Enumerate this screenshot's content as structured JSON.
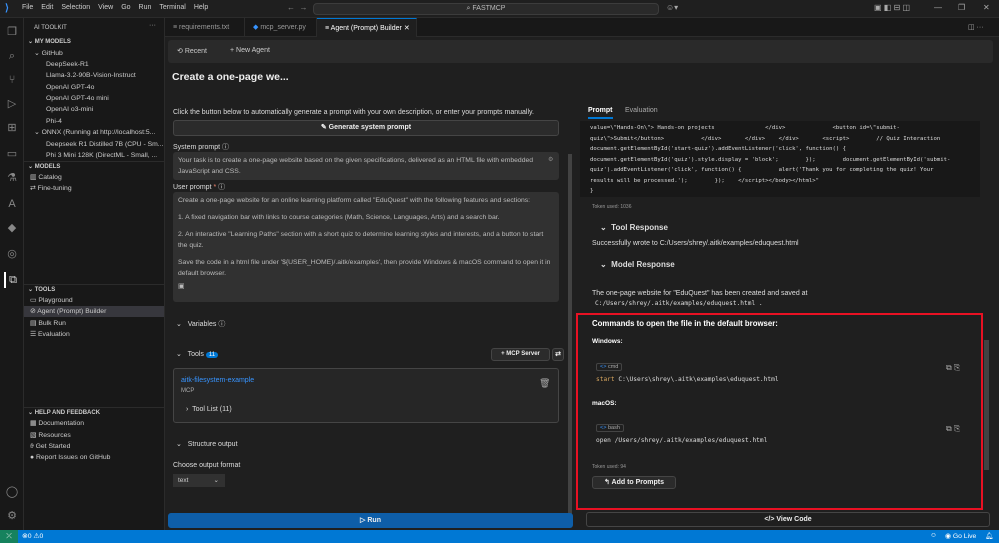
{
  "titlebar": {
    "menu": [
      "File",
      "Edit",
      "Selection",
      "View",
      "Go",
      "Run",
      "Terminal",
      "Help"
    ],
    "search": "FASTMCP"
  },
  "sidebar": {
    "title": "AI TOOLKIT",
    "my_models": "MY MODELS",
    "github": "GitHub",
    "github_models": [
      "DeepSeek-R1",
      "Llama-3.2-90B-Vision-Instruct",
      "OpenAI GPT-4o",
      "OpenAI GPT-4o mini",
      "OpenAI o3-mini",
      "Phi-4"
    ],
    "onnx": "ONNX (Running at http://localhost:5...",
    "onnx_models": [
      "Deepseek R1 Distilled 7B (CPU - Sm...",
      "Phi 3 Mini 128K (DirectML - Small, ..."
    ],
    "models": "MODELS",
    "models_items": [
      "Catalog",
      "Fine-tuning"
    ],
    "tools": "TOOLS",
    "tools_items": [
      "Playground",
      "Agent (Prompt) Builder",
      "Bulk Run",
      "Evaluation"
    ],
    "help": "HELP AND FEEDBACK",
    "help_items": [
      "Documentation",
      "Resources",
      "Get Started",
      "Report Issues on GitHub"
    ]
  },
  "tabs": [
    {
      "label": "requirements.txt"
    },
    {
      "label": "mcp_server.py"
    },
    {
      "label": "Agent (Prompt) Builder"
    }
  ],
  "toolbar": {
    "recent": "Recent",
    "new_agent": "New Agent"
  },
  "page_title": "Create a one-page we...",
  "left": {
    "hint": "Click the button below to automatically generate a prompt with your own description, or enter your prompts manually.",
    "generate": "Generate system prompt",
    "system_label": "System prompt",
    "system_prompt": "Your task is to create a one-page website based on the given specifications, delivered as an HTML file with embedded JavaScript and CSS.",
    "user_label": "User prompt",
    "required": "*",
    "user_prompt": [
      "Create a one-page website for an online learning platform called \"EduQuest\" with the following features and sections:",
      "1. A fixed navigation bar with links to course categories (Math, Science, Languages, Arts) and a search bar.",
      "2. An interactive \"Learning Paths\" section with a short quiz to determine learning styles and interests, and a button to start the quiz.",
      "Save the code in a html file under '${USER_HOME}/.aitk/examples', then provide Windows & macOS command to open it in default browser."
    ],
    "variables": "Variables",
    "tools": "Tools",
    "tools_count": "11",
    "mcp_server": "MCP Server",
    "tool_name": "aitk-filesystem-example",
    "tool_type": "MCP",
    "tool_list": "Tool List (11)",
    "structure": "Structure output",
    "format_label": "Choose output format",
    "format_value": "text",
    "run": "Run"
  },
  "right": {
    "tabs": [
      "Prompt",
      "Evaluation"
    ],
    "code": "value=\\\"Hands-On\\\"> Hands-on projects               </div>              <button id=\\\"submit-\nquiz\\\">Submit</button>           </div>       </div>    </div>       <script>        // Quiz Interaction\ndocument.getElementById('start-quiz').addEventListener('click', function() {\ndocument.getElementById('quiz').style.display = 'block';        });        document.getElementById('submit-\nquiz').addEventListener('click', function() {           alert('Thank you for completing the quiz! Your\nresults will be processed.');        });    </script></body></html>\"\n}",
    "token1": "Token used: 1036",
    "tool_response": "Tool Response",
    "tool_response_text": "Successfully wrote to C:/Users/shrey/.aitk/examples/eduquest.html",
    "model_response": "Model Response",
    "model_text": "The one-page website for \"EduQuest\" has been created and saved at",
    "model_path": "C:/Users/shrey/.aitk/examples/eduquest.html",
    "commands_heading": "Commands to open the file in the default browser:",
    "windows": "Windows:",
    "cmd_lang": "cmd",
    "cmd_kw": "start",
    "cmd_rest": " C:\\Users\\shrey\\.aitk\\examples\\eduquest.html",
    "macos": "macOS:",
    "bash_lang": "bash",
    "bash_cmd": "open /Users/shrey/.aitk/examples/eduquest.html",
    "token2": "Token used: 94",
    "add_prompts": "Add to Prompts",
    "view_code": "View Code"
  },
  "status": {
    "errors": "0",
    "warnings": "0",
    "go_live": "Go Live"
  },
  "colors": {
    "accent": "#0078d4",
    "highlight": "#e81123",
    "link": "#3794ff"
  }
}
